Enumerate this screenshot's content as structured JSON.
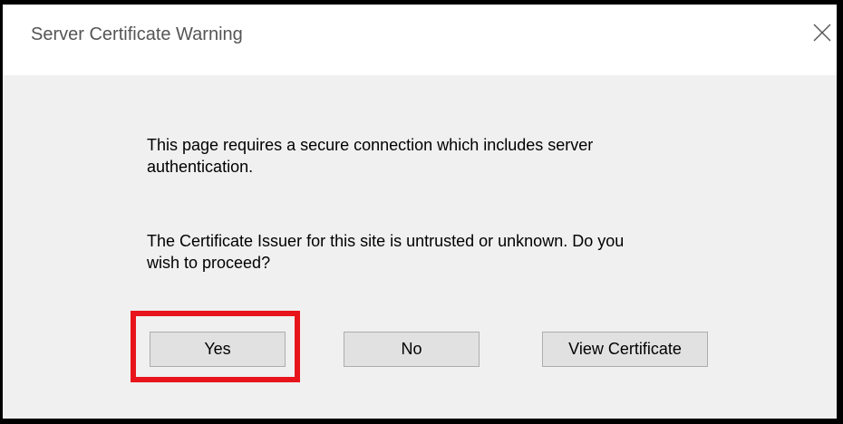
{
  "dialog": {
    "title": "Server Certificate Warning",
    "close_icon": "close-icon",
    "message_1": "This page requires a secure connection which includes server authentication.",
    "message_2": "The Certificate Issuer for this site is untrusted or unknown. Do you wish to proceed?",
    "buttons": {
      "yes": "Yes",
      "no": "No",
      "view_certificate": "View Certificate"
    },
    "highlight_color": "#e8141c"
  }
}
